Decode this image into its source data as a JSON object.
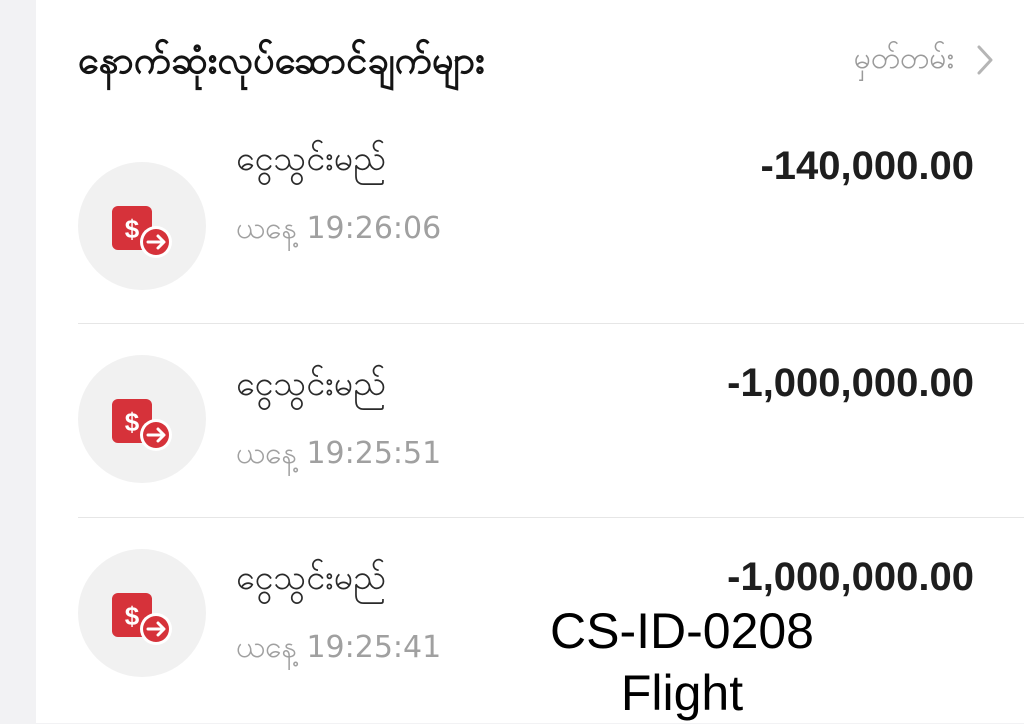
{
  "header": {
    "title": "နောက်ဆုံးလုပ်ဆောင်ချက်များ",
    "history_label": "မှတ်တမ်း"
  },
  "transactions": [
    {
      "title": "ငွေသွင်းမည်",
      "time": "ယနေ့ 19:26:06",
      "amount": "-140,000.00",
      "icon": "money-transfer-icon"
    },
    {
      "title": "ငွေသွင်းမည်",
      "time": "ယနေ့ 19:25:51",
      "amount": "-1,000,000.00",
      "icon": "money-transfer-icon"
    },
    {
      "title": "ငွေသွင်းမည်",
      "time": "ယနေ့ 19:25:41",
      "amount": "-1,000,000.00",
      "icon": "money-transfer-icon"
    }
  ],
  "watermark": {
    "line1": "CS-ID-0208",
    "line2": "Flight"
  },
  "colors": {
    "icon_red": "#d6323a",
    "background": "#f2f2f4",
    "panel": "#ffffff"
  }
}
